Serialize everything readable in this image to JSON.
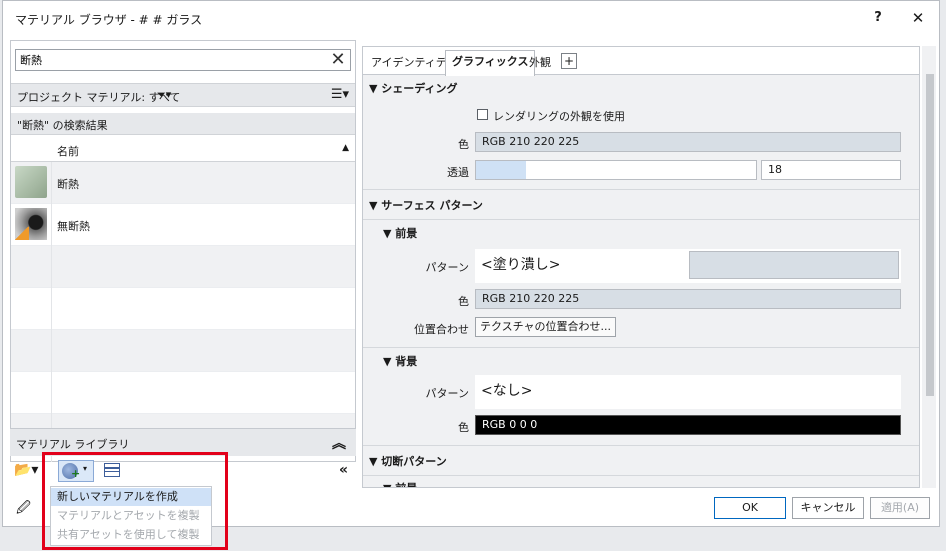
{
  "window": {
    "title": "マテリアル ブラウザ - # # ガラス",
    "help_label": "?",
    "close_label": "✕"
  },
  "left": {
    "search_value": "断熱",
    "project_label": "プロジェクト マテリアル: すべて",
    "results_label": "\"断熱\" の検索結果",
    "column_name": "名前",
    "rows": [
      {
        "label": "断熱"
      },
      {
        "label": "無断熱"
      }
    ],
    "library_label": "マテリアル ライブラリ"
  },
  "dropdown": {
    "items": [
      "新しいマテリアルを作成",
      "マテリアルとアセットを複製",
      "共有アセットを使用して複製"
    ]
  },
  "right": {
    "tabs": [
      "アイデンティティ",
      "グラフィックス",
      "外観"
    ],
    "add_tab": "+",
    "shading": {
      "title": "▼ シェーディング",
      "use_render_label": "レンダリングの外観を使用",
      "color_label": "色",
      "color_value": "RGB 210 220 225",
      "transparency_label": "透過",
      "transparency_value": "18",
      "transparency_fraction": 0.18
    },
    "surface": {
      "title": "▼ サーフェス パターン",
      "foreground_title": "▼ 前景",
      "pattern_label": "パターン",
      "fg_pattern_value": "<塗り潰し>",
      "color_label": "色",
      "fg_color_value": "RGB 210 220 225",
      "align_label": "位置合わせ",
      "align_button": "テクスチャの位置合わせ...",
      "background_title": "▼ 背景",
      "bg_pattern_value": "<なし>",
      "bg_color_value": "RGB 0 0 0"
    },
    "cut": {
      "title": "▼ 切断パターン",
      "foreground_title": "▼ 前景"
    }
  },
  "footer": {
    "ok": "OK",
    "cancel": "キャンセル",
    "apply": "適用(A)"
  },
  "colors": {
    "accent": "#0067c0",
    "highlight": "#e2001a",
    "field_bg": "#d7dee5"
  }
}
